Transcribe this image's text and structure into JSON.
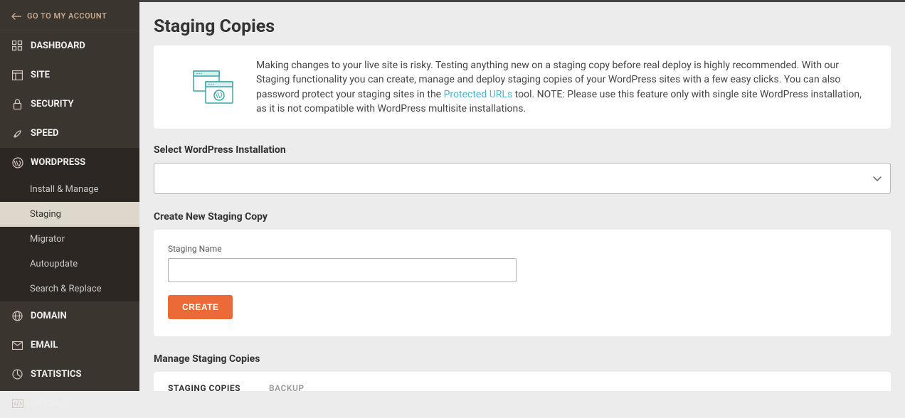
{
  "back_link": "GO TO MY ACCOUNT",
  "nav": {
    "dashboard": "DASHBOARD",
    "site": "SITE",
    "security": "SECURITY",
    "speed": "SPEED",
    "wordpress": "WORDPRESS",
    "domain": "DOMAIN",
    "email": "EMAIL",
    "statistics": "STATISTICS",
    "devs": "DEVS"
  },
  "wp_sub": {
    "install": "Install & Manage",
    "staging": "Staging",
    "migrator": "Migrator",
    "autoupdate": "Autoupdate",
    "search": "Search & Replace"
  },
  "page_title": "Staging Copies",
  "info": {
    "text1": "Making changes to your live site is risky. Testing anything new on a staging copy before real deploy is highly recommended. With our Staging functionality you can create, manage and deploy staging copies of your WordPress sites with a few easy clicks. You can also password protect your staging sites in the ",
    "link": "Protected URLs",
    "text2": " tool. NOTE: Please use this feature only with single site WordPress installation, as it is not compatible with WordPress multisite installations."
  },
  "select_label": "Select WordPress Installation",
  "create_section_label": "Create New Staging Copy",
  "staging_name_label": "Staging Name",
  "create_button": "CREATE",
  "manage_label": "Manage Staging Copies",
  "tabs": {
    "staging_copies": "STAGING COPIES",
    "backup": "BACKUP"
  }
}
